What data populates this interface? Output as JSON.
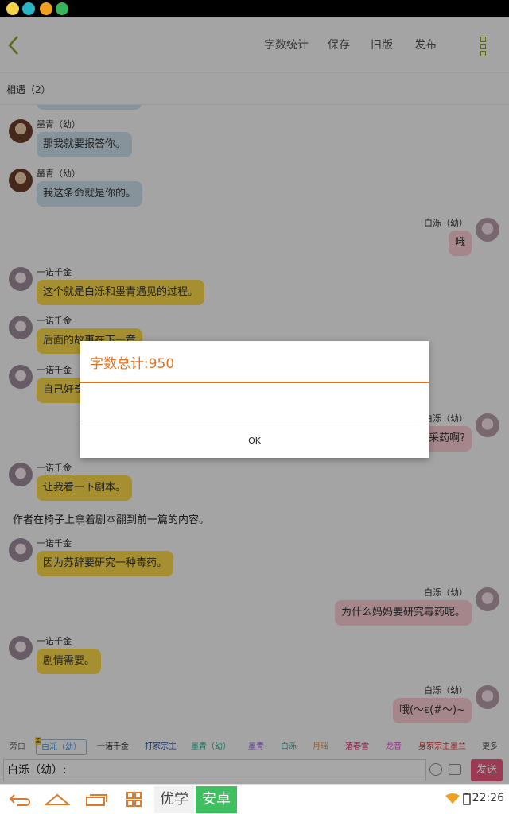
{
  "toolbar": {
    "items": [
      "字数统计",
      "保存",
      "旧版",
      "发布"
    ]
  },
  "subheader": "相遇（2）",
  "messages": [
    {
      "speaker": "墨青（幼）",
      "text": "那我就要报答你。"
    },
    {
      "speaker": "墨青（幼）",
      "text": "我这条命就是你的。"
    },
    {
      "speaker": "白泺（幼）",
      "text": "哦"
    },
    {
      "speaker": "一诺千金",
      "text": "这个就是白泺和墨青遇见的过程。"
    },
    {
      "speaker": "一诺千金",
      "text": "后面的故事在下一章"
    },
    {
      "speaker": "一诺千金",
      "text": "自己好奇"
    },
    {
      "speaker": "白泺（幼）",
      "text": "采药啊?"
    },
    {
      "speaker": "一诺千金",
      "text": "让我看一下剧本。"
    },
    {
      "narration": "作者在椅子上拿着剧本翻到前一篇的内容。"
    },
    {
      "speaker": "一诺千金",
      "text": "因为苏辞要研究一种毒药。"
    },
    {
      "speaker": "白泺（幼）",
      "text": "为什么妈妈要研究毒药呢。"
    },
    {
      "speaker": "一诺千金",
      "text": "剧情需要。"
    },
    {
      "speaker": "白泺（幼）",
      "text": "哦(～ε(#～)~"
    }
  ],
  "character_bar": {
    "chips": [
      "旁白",
      "白泺（幼）",
      "一诺千金",
      "打家宗主",
      "墨青（幼）",
      "墨青",
      "白泺",
      "月瑶",
      "落春雪",
      "龙音",
      "身家宗主墨兰",
      "更多"
    ],
    "chip_colors": [
      "#666666",
      "#4a8fd0",
      "#333333",
      "#2a4a9a",
      "#2aaa8a",
      "#8a5ac8",
      "#2aaa9a",
      "#e0904a",
      "#d02a6a",
      "#d050c0",
      "#d03a3a",
      "#555555"
    ],
    "badge": "主"
  },
  "input": {
    "value": "白泺（幼）:"
  },
  "send_label": "发送",
  "navbar": {
    "youxue": "优学",
    "anzhuo": "安卓",
    "time": "22:26"
  },
  "dialog": {
    "title": "字数总计:950",
    "ok": "OK"
  },
  "colors": {
    "accent": "#e4731e",
    "send": "#e9557d",
    "green": "#3fbf5f"
  }
}
